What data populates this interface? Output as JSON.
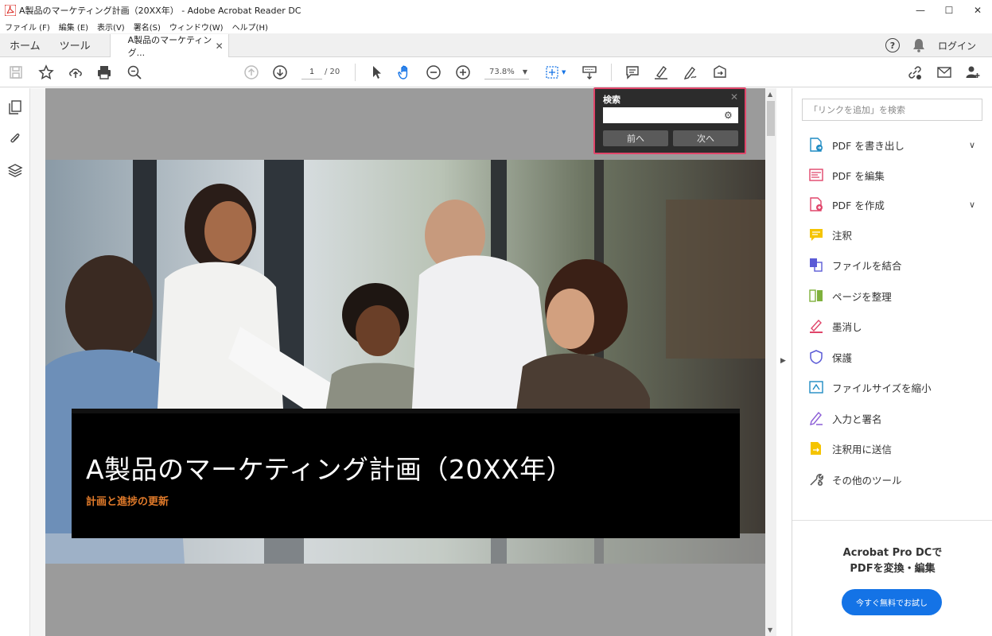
{
  "window": {
    "title": "A製品のマーケティング計画（20XX年） - Adobe Acrobat Reader DC",
    "minimize": "—",
    "maximize": "☐",
    "close": "✕"
  },
  "menu": [
    "ファイル (F)",
    "編集 (E)",
    "表示(V)",
    "署名(S)",
    "ウィンドウ(W)",
    "ヘルプ(H)"
  ],
  "tabs": {
    "home": "ホーム",
    "tools": "ツール",
    "document": "A製品のマーケティング...",
    "close": "✕"
  },
  "header_right": {
    "help": "?",
    "login": "ログイン"
  },
  "toolbar": {
    "page_current": "1",
    "page_total": "/ 20",
    "zoom": "73.8%"
  },
  "search_popup": {
    "title": "検索",
    "close": "✕",
    "prev": "前へ",
    "next": "次へ"
  },
  "document": {
    "title": "A製品のマーケティング計画（20XX年）",
    "subtitle": "計画と進捗の更新"
  },
  "right_panel": {
    "search_placeholder": "「リンクを追加」を検索",
    "tools": [
      {
        "label": "PDF を書き出し",
        "icon": "export-pdf-icon",
        "color": "#1e8bc3"
      },
      {
        "label": "PDF を編集",
        "icon": "edit-pdf-icon",
        "color": "#e0456a"
      },
      {
        "label": "PDF を作成",
        "icon": "create-pdf-icon",
        "color": "#e0456a"
      },
      {
        "label": "注釈",
        "icon": "comment-icon",
        "color": "#f5c400"
      },
      {
        "label": "ファイルを結合",
        "icon": "combine-files-icon",
        "color": "#5b5bd6"
      },
      {
        "label": "ページを整理",
        "icon": "organize-pages-icon",
        "color": "#7fb13d"
      },
      {
        "label": "墨消し",
        "icon": "redact-icon",
        "color": "#e0456a"
      },
      {
        "label": "保護",
        "icon": "protect-icon",
        "color": "#5b5bd6"
      },
      {
        "label": "ファイルサイズを縮小",
        "icon": "compress-icon",
        "color": "#1e8bc3"
      },
      {
        "label": "入力と署名",
        "icon": "fill-sign-icon",
        "color": "#8b5cd6"
      },
      {
        "label": "注釈用に送信",
        "icon": "send-comments-icon",
        "color": "#f5c400"
      },
      {
        "label": "その他のツール",
        "icon": "more-tools-icon",
        "color": "#555555"
      }
    ],
    "promo_line1": "Acrobat Pro DCで",
    "promo_line2": "PDFを変換・編集",
    "try_button": "今すぐ無料でお試し"
  },
  "colors": {
    "accent": "#1473e6",
    "popup_border": "#e0456a",
    "subtitle": "#e07a2a"
  }
}
